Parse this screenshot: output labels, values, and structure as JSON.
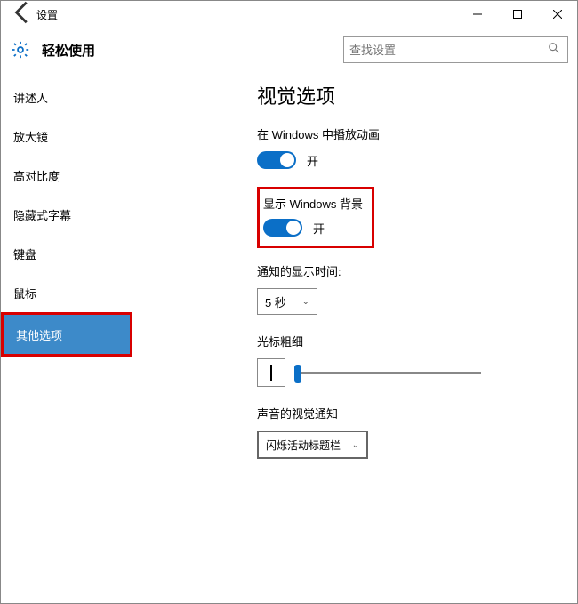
{
  "window": {
    "title": "设置",
    "minimize": "–",
    "maximize": "□",
    "close": "×"
  },
  "header": {
    "page_title": "轻松使用",
    "search_placeholder": "查找设置"
  },
  "sidebar": {
    "items": [
      {
        "label": "讲述人"
      },
      {
        "label": "放大镜"
      },
      {
        "label": "高对比度"
      },
      {
        "label": "隐藏式字幕"
      },
      {
        "label": "键盘"
      },
      {
        "label": "鼠标"
      },
      {
        "label": "其他选项",
        "selected": true,
        "highlighted": true
      }
    ]
  },
  "content": {
    "heading": "视觉选项",
    "animations": {
      "label": "在 Windows 中播放动画",
      "state": "开",
      "on": true
    },
    "background": {
      "label": "显示 Windows 背景",
      "state": "开",
      "on": true,
      "highlighted": true
    },
    "notify_time": {
      "label": "通知的显示时间:",
      "value": "5 秒"
    },
    "cursor": {
      "label": "光标粗细"
    },
    "sound_visual": {
      "label": "声音的视觉通知",
      "value": "闪烁活动标题栏"
    }
  }
}
